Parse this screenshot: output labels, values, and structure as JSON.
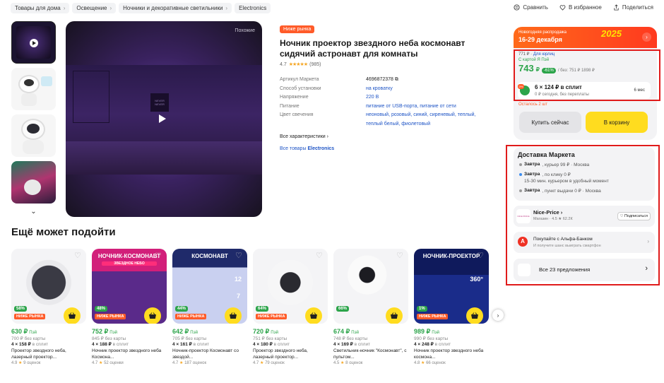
{
  "breadcrumbs": [
    "Товары для дома",
    "Освещение",
    "Ночники и декоративные светильники",
    "Electronics"
  ],
  "header_actions": {
    "compare": "Сравнить",
    "favorite": "В избранное",
    "share": "Поделиться"
  },
  "gallery": {
    "similar_label": "Похожие",
    "poster_text": "NEVER NEVER"
  },
  "product": {
    "badge": "Ниже рынка",
    "title": "Ночник проектор звездного неба космонавт сидячий астронавт для комнаты",
    "rating": "4.7",
    "reviews": "(985)",
    "props": [
      {
        "key": "Артикул Маркета",
        "value": "4696872378"
      },
      {
        "key": "Способ установки",
        "value": "на кроватку"
      },
      {
        "key": "Напряжение",
        "value": "220 В"
      },
      {
        "key": "Питание",
        "value": "питание от USB-порта, питание от сети"
      },
      {
        "key": "Цвет свечения",
        "value": "неоновый, розовый, синий, сиреневый, теплый, теплый белый, фиолетовый"
      }
    ],
    "all_chars": "Все характеристики",
    "brand_link_prefix": "Все товары",
    "brand": "Electronics"
  },
  "buybox": {
    "promo_line1": "Новогодняя распродажа",
    "promo_line2": "16-29 декабря",
    "promo_year": "2025",
    "top_line": "771 ₽",
    "for_legal": "Для юрлиц",
    "card_label": "С картой Я Пэй",
    "price": "743",
    "currency": "₽",
    "discount": "-61%",
    "old_price": "/ без: 751 ₽ 1898 ₽",
    "split_badge": "0%",
    "split_title": "6 × 124 ₽ в сплит",
    "split_sub": "0 ₽ сегодня, без переплаты",
    "split_term": "6 мес",
    "stock_left": "Осталось 2 шт",
    "buy_now": "Купить сейчас",
    "to_cart": "В корзину"
  },
  "delivery": {
    "title": "Доставка Маркета",
    "lines": [
      {
        "bold": "Завтра",
        "rest": ", курьер  99 ₽ · Москва"
      },
      {
        "bold": "Завтра",
        "rest": ", по клику  0 ₽"
      },
      {
        "bold": "",
        "rest": "15-30 мин. курьером в удобный момент"
      },
      {
        "bold": "Завтра",
        "rest": ", пункт выдачи  0 ₽ · Москва"
      }
    ]
  },
  "shop": {
    "logo": "NICE PRICE",
    "name": "Nice-Price",
    "meta": "Магазин · 4.5 ★ 62.2К",
    "subscribe": "Подписаться"
  },
  "alfa": {
    "letter": "А",
    "title": "Покупайте с Альфа-Банком",
    "sub": "И получите шанс выиграть смартфон"
  },
  "offers": {
    "label": "Все 23 предложения"
  },
  "recommend": {
    "title": "Ещё может подойти",
    "low_label": "НИЖЕ РЫНКА",
    "cards": [
      {
        "pct": "58%",
        "low": true,
        "price": "630 ₽",
        "pay": "Пэй",
        "nocard": "700 ₽ без карты",
        "split": "4 × 158 ₽",
        "split_rest": " в сплит",
        "name": "Проектор звездного неба, лазерный проектор...",
        "rating": "4.9",
        "reviews": "9 оценок"
      },
      {
        "pct": "48%",
        "low": true,
        "price": "752 ₽",
        "pay": "Пэй",
        "nocard": "845 ₽ без карты",
        "split": "4 × 188 ₽",
        "split_rest": " в сплит",
        "name": "Ночник проектор звездного неба Космона...",
        "rating": "4.7",
        "reviews": "52 оценки",
        "art_title": "НОЧНИК-КОСМОНАВТ",
        "art_sub": "ЗВЕЗДНОЕ НЕБО"
      },
      {
        "pct": "44%",
        "low": true,
        "price": "642 ₽",
        "pay": "Пэй",
        "nocard": "705 ₽ без карты",
        "split": "4 × 161 ₽",
        "split_rest": " в сплит",
        "name": "Ночник-проектор Космонавт со звездой...",
        "rating": "4.7",
        "reviews": "187 оценок",
        "art_title": "КОСМОНАВТ",
        "art_n1": "12",
        "art_n2": "7"
      },
      {
        "pct": "64%",
        "low": true,
        "price": "720 ₽",
        "pay": "Пэй",
        "nocard": "751 ₽ без карты",
        "split": "4 × 180 ₽",
        "split_rest": " в сплит",
        "name": "Проектор звездного неба, лазерный проектор...",
        "rating": "4.7",
        "reviews": "79 оценок"
      },
      {
        "pct": "66%",
        "low": false,
        "price": "674 ₽",
        "pay": "Пэй",
        "nocard": "748 ₽ без карты",
        "split": "4 × 169 ₽",
        "split_rest": " в сплит",
        "name": "Светильник-ночник \"Космонавт\", с пультом...",
        "rating": "4.5",
        "reviews": "8 оценок"
      },
      {
        "pct": "1%",
        "low": true,
        "price": "989 ₽",
        "pay": "Пэй",
        "nocard": "990 ₽ без карты",
        "split": "4 × 248 ₽",
        "split_rest": " в сплит",
        "name": "Ночник проектор звездного неба космона...",
        "rating": "4.8",
        "reviews": "66 оценок",
        "art_title": "НОЧНИК-ПРОЕКТОР",
        "art_n1": "360°"
      }
    ]
  },
  "colors": {
    "green": "#2ca44a",
    "orange": "#ff5b29",
    "yellow": "#ffdc1f",
    "link": "#1f55c6",
    "red_outline": "#e01b1b"
  }
}
